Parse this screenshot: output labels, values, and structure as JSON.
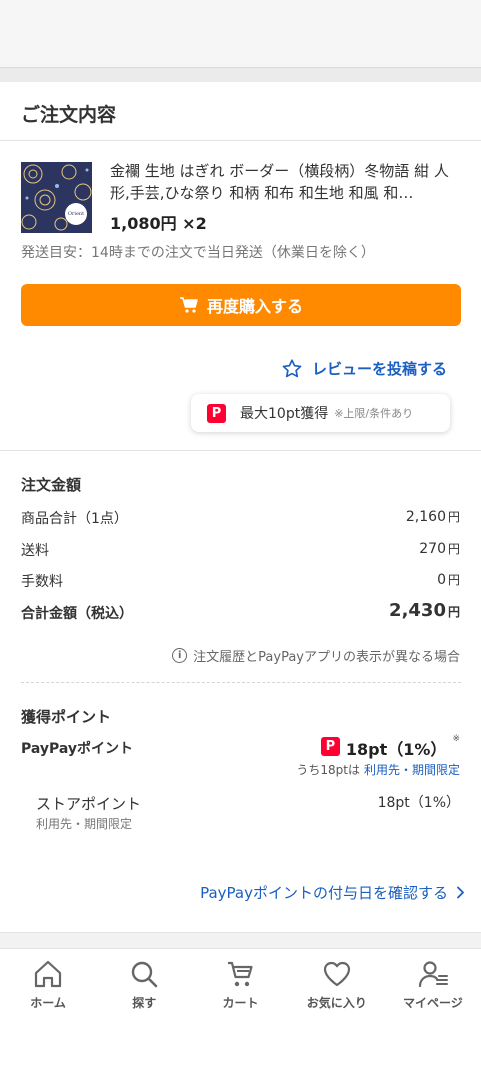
{
  "section_title": "ご注文内容",
  "product": {
    "name": "金襴 生地 はぎれ ボーダー（横段柄）冬物語 紺 人形,手芸,ひな祭り 和柄 和布 和生地 和風 和…",
    "price": "1,080円 ×2",
    "shipping_note": "発送目安：14時までの注文で当日発送（休業日を除く）"
  },
  "rebuy_button": "再度購入する",
  "review": {
    "label": "レビューを投稿する",
    "tooltip_main": "最大10pt獲得",
    "tooltip_sub": "※上限/条件あり"
  },
  "summary": {
    "title": "注文金額",
    "rows": [
      {
        "label": "商品合計（1点）",
        "value": "2,160",
        "unit": "円"
      },
      {
        "label": "送料",
        "value": "270",
        "unit": "円"
      },
      {
        "label": "手数料",
        "value": "0",
        "unit": "円"
      }
    ],
    "total_label": "合計金額（税込）",
    "total_value": "2,430",
    "total_unit": "円",
    "notice": "注文履歴とPayPayアプリの表示が異なる場合"
  },
  "points": {
    "title": "獲得ポイント",
    "paypay_label": "PayPayポイント",
    "paypay_value": "18pt（1%）",
    "paypay_mark": "※",
    "paypay_note_prefix": "うち18ptは",
    "paypay_note_link": "利用先・期間限定",
    "store_label": "ストアポイント",
    "store_sub": "利用先・期間限定",
    "store_value": "18pt（1%）",
    "confirm_link": "PayPayポイントの付与日を確認する"
  },
  "tabs": [
    {
      "label": "ホーム",
      "icon": "home-icon"
    },
    {
      "label": "探す",
      "icon": "search-icon"
    },
    {
      "label": "カート",
      "icon": "cart-icon"
    },
    {
      "label": "お気に入り",
      "icon": "heart-icon"
    },
    {
      "label": "マイページ",
      "icon": "user-icon"
    }
  ],
  "colors": {
    "accent_orange": "#ff8a00",
    "link_blue": "#1a5fc1",
    "paypay_red": "#ff0033"
  }
}
